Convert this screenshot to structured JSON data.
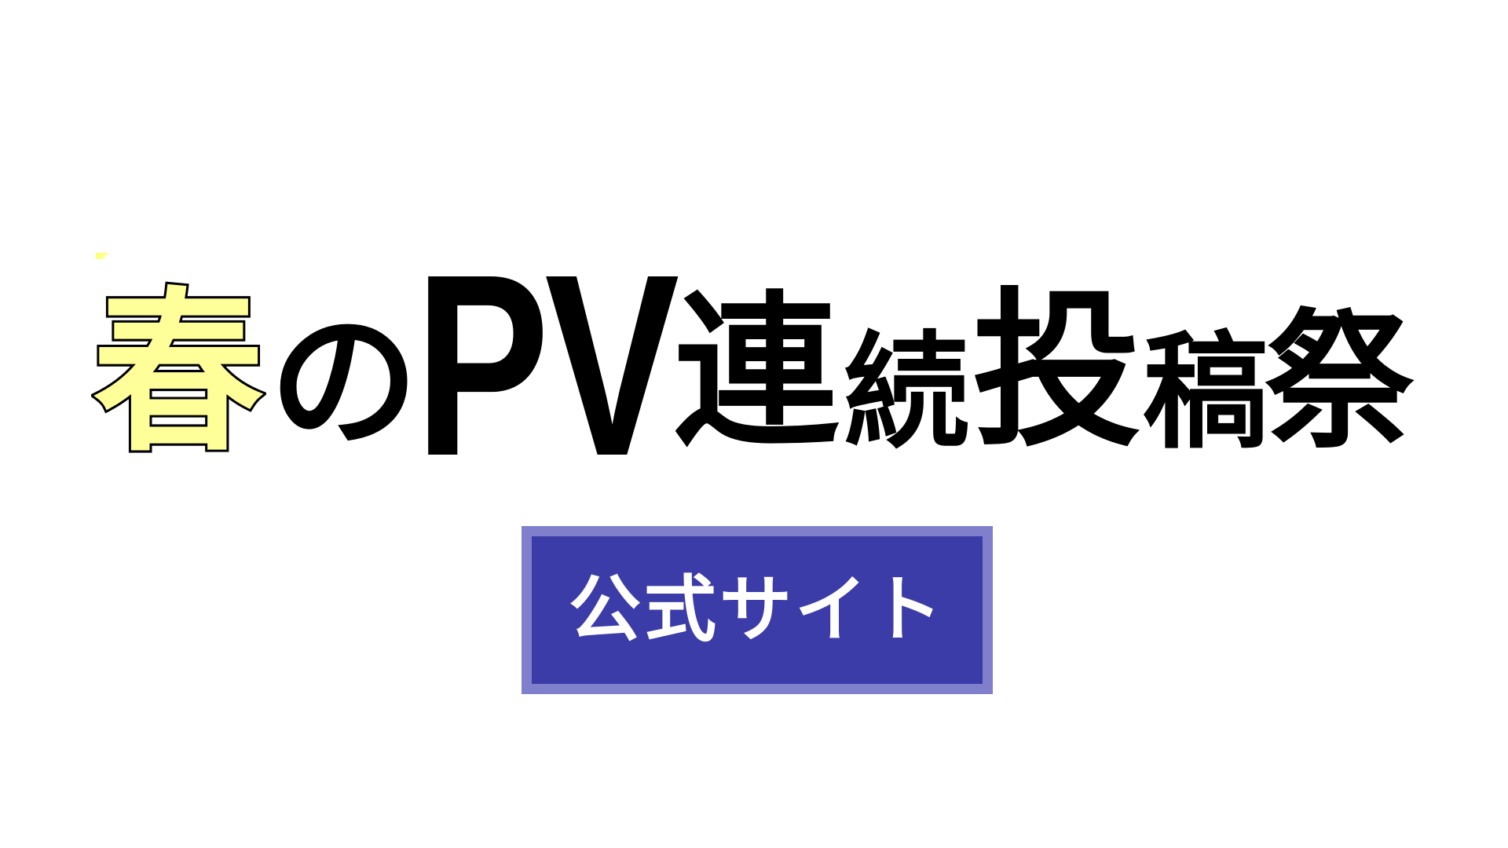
{
  "title": {
    "haru": "春",
    "no": "の",
    "pv": "PV",
    "ren": "連",
    "zoku": "続",
    "tou": "投",
    "kou": "稿",
    "sai": "祭"
  },
  "button": {
    "label": "公式サイト"
  },
  "colors": {
    "background": "#ffffff",
    "text": "#000000",
    "haru_fill": "#ffff99",
    "button_fill": "#3c3ca8",
    "button_border": "#7f7fcc",
    "button_text": "#ffffff"
  }
}
